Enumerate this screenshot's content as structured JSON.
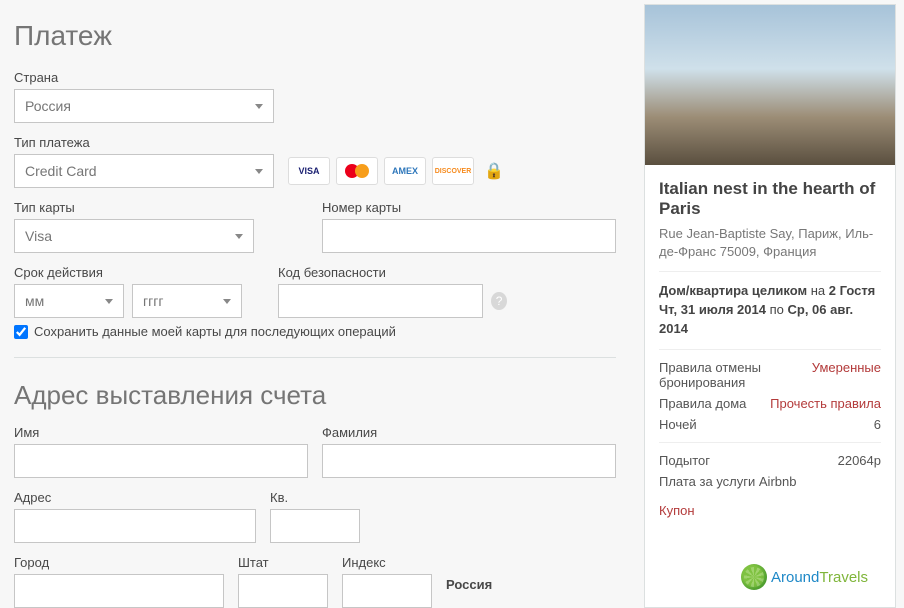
{
  "payment": {
    "title": "Платеж",
    "country_label": "Страна",
    "country_value": "Россия",
    "type_label": "Тип платежа",
    "type_value": "Credit Card",
    "cards": {
      "visa": "VISA",
      "amex": "AMEX",
      "discover": "DISCOVER"
    },
    "card_type_label": "Тип карты",
    "card_type_value": "Visa",
    "card_number_label": "Номер карты",
    "exp_label": "Срок действия",
    "exp_month_ph": "мм",
    "exp_year_ph": "гггг",
    "cvv_label": "Код безопасности",
    "save_label": "Сохранить данные моей карты для последующих операций"
  },
  "billing": {
    "title": "Адрес выставления счета",
    "first_label": "Имя",
    "last_label": "Фамилия",
    "addr_label": "Адрес",
    "apt_label": "Кв.",
    "city_label": "Город",
    "state_label": "Штат",
    "zip_label": "Индекс",
    "country_static": "Россия"
  },
  "summary": {
    "title": "Italian nest in the hearth of Paris",
    "address": "Rue Jean-Baptiste Say, Париж, Иль-де-Франс 75009, Франция",
    "room": "Дом/квартира целиком",
    "for_word": "на",
    "guests": "2 Гостя",
    "date_from": "Чт, 31 июля 2014",
    "date_join": "по",
    "date_to": "Ср, 06 авг. 2014",
    "cancel_label": "Правила отмены бронирования",
    "cancel_val": "Умеренные",
    "rules_label": "Правила дома",
    "rules_val": "Прочесть правила",
    "nights_label": "Ночей",
    "nights_val": "6",
    "subtotal_label": "Подытог",
    "subtotal_val": "22064p",
    "fee_label": "Плата за услуги Airbnb",
    "coupon": "Купон"
  },
  "watermark": {
    "a": "Around",
    "b": "Travels"
  }
}
